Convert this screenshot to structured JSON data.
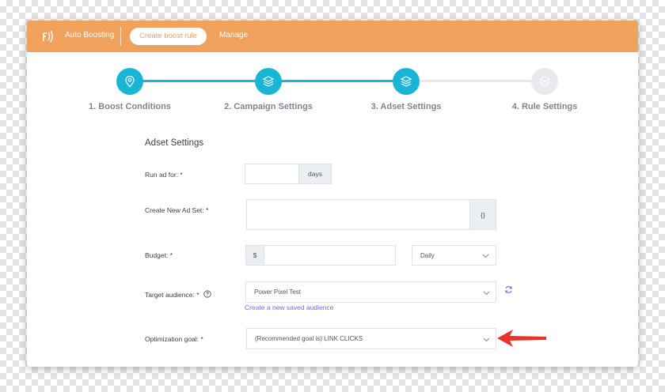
{
  "topbar": {
    "brand": "Auto Boosting",
    "active_pill": "Create boost rule",
    "manage": "Manage",
    "color": "#f0a15c"
  },
  "steps": [
    {
      "label": "1. Boost Conditions",
      "icon": "map-pin-icon",
      "state": "complete"
    },
    {
      "label": "2. Campaign Settings",
      "icon": "layers-icon",
      "state": "complete"
    },
    {
      "label": "3. Adset Settings",
      "icon": "layers-icon",
      "state": "current"
    },
    {
      "label": "4. Rule Settings",
      "icon": "layers-icon",
      "state": "inactive"
    }
  ],
  "accent_color": "#19b5d6",
  "form": {
    "section_title": "Adset Settings",
    "run_ad": {
      "label": "Run ad for: *",
      "value": "",
      "unit": "days"
    },
    "new_ad_set": {
      "label": "Create New Ad Set: *",
      "value": "",
      "addon": "{}"
    },
    "budget": {
      "label": "Budget: *",
      "currency": "$",
      "value": "",
      "period": "Daily"
    },
    "target_audience": {
      "label": "Target audience: *",
      "value": "Power Pixel Test",
      "link": "Create a new saved audience",
      "help_icon": "question-circle-icon",
      "refresh_icon": "refresh-icon"
    },
    "optimization_goal": {
      "label": "Optimization goal: *",
      "value": "(Recommended goal is) LINK CLICKS"
    }
  },
  "annotation": {
    "icon": "red-arrow-icon",
    "color": "#e8332a"
  }
}
